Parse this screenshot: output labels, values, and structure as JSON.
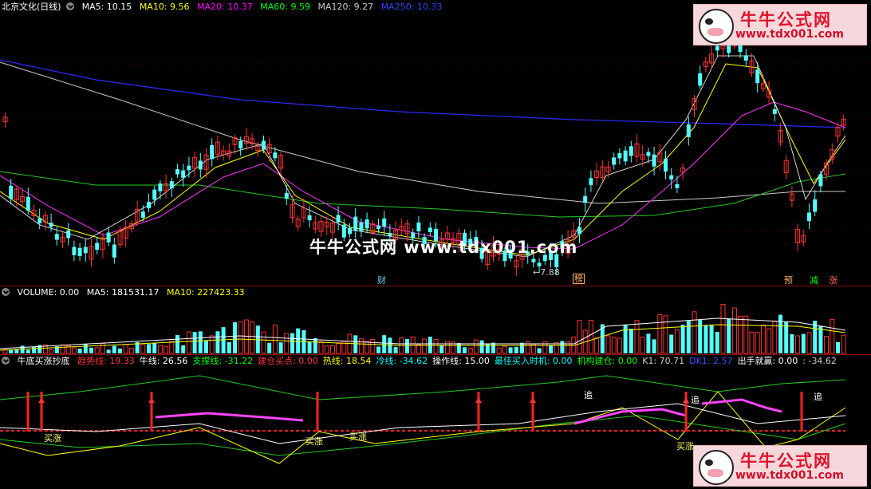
{
  "main": {
    "title": "北京文化(日线)",
    "ma": [
      {
        "label": "MA5: 10.15",
        "color": "#ffffff"
      },
      {
        "label": "MA10: 9.56",
        "color": "#ffff00"
      },
      {
        "label": "MA20: 10.37",
        "color": "#ff00ff"
      },
      {
        "label": "MA60: 9.59",
        "color": "#00ff00"
      },
      {
        "label": "MA120: 9.27",
        "color": "#cccccc"
      },
      {
        "label": "MA250: 10.33",
        "color": "#3333ff"
      }
    ],
    "low_marker": "7.88",
    "watermark": "牛牛公式网 www.tdx001.com",
    "event_tags": [
      {
        "text": "财",
        "color": "#5fd8ff"
      },
      {
        "text": "榜",
        "color": "#ffb060"
      },
      {
        "text": "预",
        "color": "#ffb060"
      },
      {
        "text": "减",
        "color": "#00ff00"
      },
      {
        "text": "涨",
        "color": "#ff6060"
      }
    ]
  },
  "volume": {
    "title": "VOLUME: 0.00",
    "ma5": "MA5: 181531.17",
    "ma10": "MA10: 227423.33"
  },
  "indicator": {
    "name": "牛底买涨抄底",
    "fields": [
      {
        "label": "趋势线: 19.33",
        "color": "#ff3333"
      },
      {
        "label": "牛线: 26.56",
        "color": "#ffffff"
      },
      {
        "label": "支撑线: -31.22",
        "color": "#00ff00"
      },
      {
        "label": "建仓买点: 0.00",
        "color": "#ff3333"
      },
      {
        "label": "热线: 18.54",
        "color": "#ffff00"
      },
      {
        "label": "冷线: -34.62",
        "color": "#00ffff"
      },
      {
        "label": "操作线: 15.00",
        "color": "#ffffff"
      },
      {
        "label": "最佳买入时机: 0.00",
        "color": "#00ffff"
      },
      {
        "label": "机构建仓: 0.00",
        "color": "#00ff00"
      },
      {
        "label": "K1: 70.71",
        "color": "#cccccc"
      },
      {
        "label": "DK1: 2.57",
        "color": "#3355ff"
      },
      {
        "label": "出手就赢: 0.00",
        "color": "#ffffff"
      },
      {
        "label": ": -34.62",
        "color": "#cccccc"
      }
    ],
    "signals": [
      "买涨",
      "买涨",
      "买涨",
      "买涨",
      "追",
      "追",
      "追"
    ]
  },
  "logo": {
    "title": "牛牛公式网",
    "url": "www.tdx001.com"
  }
}
